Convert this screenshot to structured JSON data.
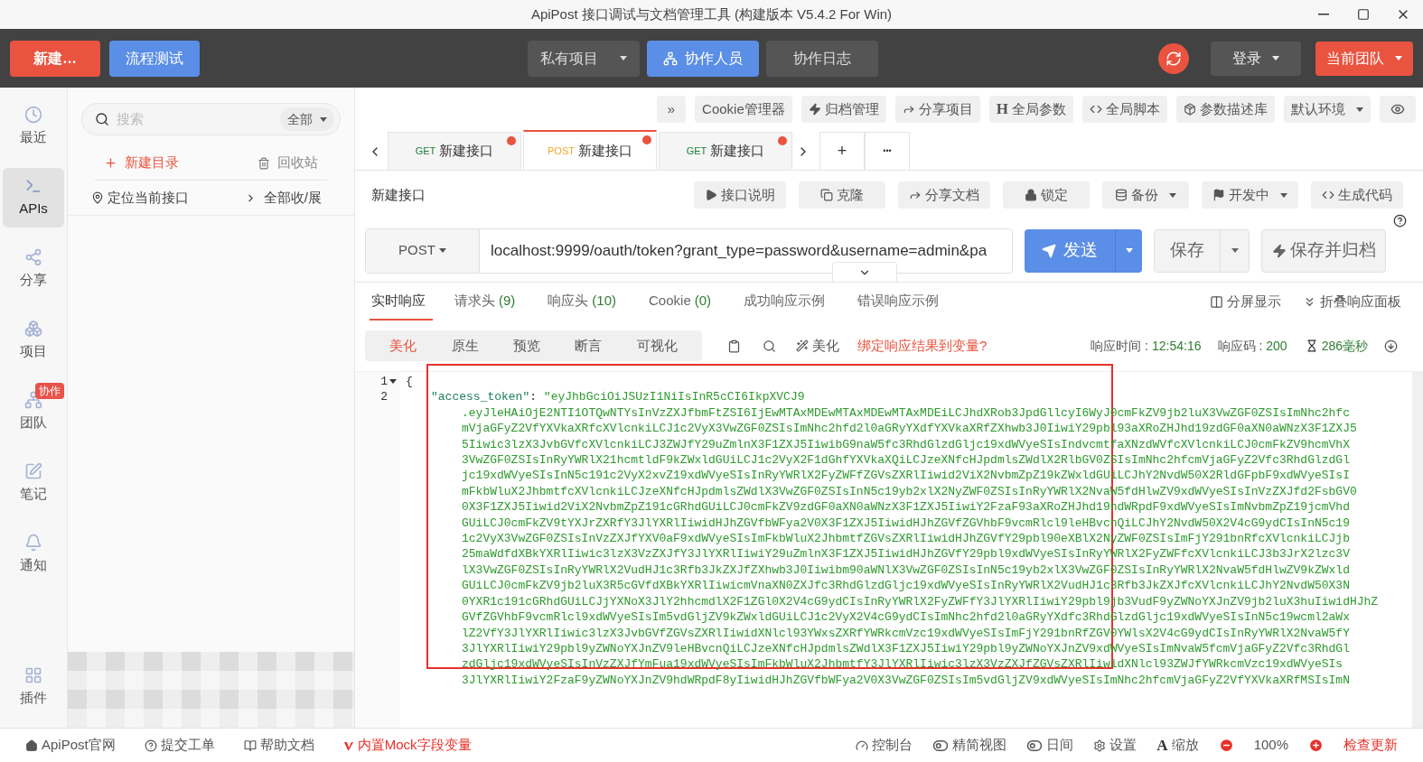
{
  "window": {
    "title": "ApiPost 接口调试与文档管理工具 (构建版本 V5.4.2 For Win)"
  },
  "top_bar": {
    "new_button": "新建…",
    "flow_button": "流程测试",
    "tabs": [
      {
        "label": "私有项目",
        "kind": "dropdown",
        "selected": false
      },
      {
        "label": "协作人员",
        "kind": "team",
        "selected": true
      },
      {
        "label": "协作日志",
        "kind": "plain",
        "selected": false
      }
    ],
    "login": "登录",
    "team": "当前团队"
  },
  "rail": {
    "items": [
      {
        "label": "最近",
        "kind": "clock",
        "selected": false
      },
      {
        "label": "APIs",
        "kind": "terminal",
        "selected": true
      },
      {
        "label": "分享",
        "kind": "share",
        "selected": false
      },
      {
        "label": "项目",
        "kind": "boxes",
        "selected": false
      },
      {
        "label": "团队",
        "kind": "team",
        "selected": false,
        "badge": "协作"
      },
      {
        "label": "笔记",
        "kind": "note",
        "selected": false
      },
      {
        "label": "通知",
        "kind": "bell",
        "selected": false
      }
    ],
    "bottom": {
      "label": "插件",
      "kind": "grid",
      "selected": false
    }
  },
  "sidebar": {
    "search": {
      "placeholder": "搜索",
      "filter": "全部"
    },
    "new_folder": "新建目录",
    "trash": "回收站",
    "locate": "定位当前接口",
    "toggle_all": "全部收/展"
  },
  "toolbar": [
    {
      "kind": "more",
      "label": "»"
    },
    {
      "kind": "plain",
      "label": "Cookie管理器"
    },
    {
      "kind": "bolt",
      "label": "归档管理"
    },
    {
      "kind": "share",
      "label": "分享项目"
    },
    {
      "kind": "glyph",
      "glyph": "H",
      "label": "全局参数"
    },
    {
      "kind": "code",
      "label": "全局脚本"
    },
    {
      "kind": "box",
      "label": "参数描述库"
    },
    {
      "kind": "dropdown",
      "label": "默认环境"
    },
    {
      "kind": "eye"
    }
  ],
  "tabs": [
    {
      "method": "GET",
      "label": "新建接口",
      "unsaved": true,
      "selected": false
    },
    {
      "method": "POST",
      "label": "新建接口",
      "unsaved": true,
      "selected": true
    },
    {
      "method": "GET",
      "label": "新建接口",
      "unsaved": true,
      "selected": false
    }
  ],
  "tab_controls": {
    "add": "+",
    "more": "•••"
  },
  "request": {
    "name": "新建接口",
    "actions": [
      {
        "kind": "play",
        "label": "接口说明"
      },
      {
        "kind": "copy",
        "label": "克隆"
      },
      {
        "kind": "share",
        "label": "分享文档"
      },
      {
        "kind": "lock",
        "label": "锁定"
      },
      {
        "kind": "database",
        "label": "备份",
        "dropdown": true
      },
      {
        "kind": "flag",
        "label": "开发中",
        "dropdown": true
      },
      {
        "kind": "code",
        "label": "生成代码"
      }
    ],
    "method": "POST",
    "url": "localhost:9999/oauth/token?grant_type=password&username=admin&pa",
    "send": "发送",
    "save": "保存",
    "save_archive": "保存并归档"
  },
  "response_tabs": [
    {
      "label": "实时响应",
      "selected": true
    },
    {
      "label": "请求头",
      "count": "(9)",
      "selected": false
    },
    {
      "label": "响应头",
      "count": "(10)",
      "selected": false
    },
    {
      "label": "Cookie",
      "count": "(0)",
      "selected": false
    },
    {
      "label": "成功响应示例",
      "selected": false
    },
    {
      "label": "错误响应示例",
      "selected": false
    }
  ],
  "response_actions": {
    "split": "分屏显示",
    "collapse": "折叠响应面板"
  },
  "view_modes": [
    {
      "label": "美化",
      "selected": true
    },
    {
      "label": "原生",
      "selected": false
    },
    {
      "label": "预览",
      "selected": false
    },
    {
      "label": "断言",
      "selected": false
    },
    {
      "label": "可视化",
      "selected": false
    }
  ],
  "beautify": "美化",
  "bind_link": "绑定响应结果到变量?",
  "meta": {
    "time_label": "响应时间 :",
    "time": "12:54:16",
    "code_label": "响应码 :",
    "code": "200",
    "duration": "286毫秒"
  },
  "code": {
    "line_numbers": [
      "1",
      "2"
    ],
    "open_brace": "{",
    "key": "\"access_token\"",
    "colon": ":",
    "first": "\"eyJhbGciOiJSUzI1NiIsInR5cCI6IkpXVCJ9",
    "lines": [
      ".eyJleHAiOjE2NTI1OTQwNTYsInVzZXJfbmFtZSI6IjEwMTAxMDEwMTAxMDEwMTAxMDEiLCJhdXRob3JpdGllcyI6WyJ0cmFkZV9jb2luX3VwZGF0ZSIsImNhc2hfc",
      "mVjaGFyZ2VfYXVkaXRfcXVlcnkiLCJ1c2VyX3VwZGF0ZSIsImNhc2hfd2l0aGRyYXdfYXVkaXRfZXhwb3J0IiwiY29pbl93aXRoZHJhd19zdGF0aXN0aWNzX3F1ZXJ5",
      "5Iiwic3lzX3JvbGVfcXVlcnkiLCJ3ZWJfY29uZmlnX3F1ZXJ5IiwibG9naW5fc3RhdGlzdGljc19xdWVyeSIsIndvcmtfaXNzdWVfcXVlcnkiLCJ0cmFkZV9hcmVhX",
      "3VwZGF0ZSIsInRyYWRlX21hcmtldF9kZWxldGUiLCJ1c2VyX2F1dGhfYXVkaXQiLCJzeXNfcHJpdmlsZWdlX2RlbGV0ZSIsImNhc2hfcmVjaGFyZ2Vfc3RhdGlzdGl",
      "jc19xdWVyeSIsInN5c191c2VyX2xvZ19xdWVyeSIsInRyYWRlX2FyZWFfZGVsZXRlIiwid2ViX2NvbmZpZ19kZWxldGUiLCJhY2NvdW50X2RldGFpbF9xdWVyeSIsI",
      "mFkbWluX2JhbmtfcXVlcnkiLCJzeXNfcHJpdmlsZWdlX3VwZGF0ZSIsInN5c19yb2xlX2NyZWF0ZSIsInRyYWRlX2NvaW5fdHlwZV9xdWVyeSIsInVzZXJfd2FsbGV0",
      "0X3F1ZXJ5Iiwid2ViX2NvbmZpZ191cGRhdGUiLCJ0cmFkZV9zdGF0aXN0aWNzX3F1ZXJ5IiwiY2FzaF93aXRoZHJhd19hdWRpdF9xdWVyeSIsImNvbmZpZ19jcmVhd",
      "GUiLCJ0cmFkZV9tYXJrZXRfY3JlYXRlIiwidHJhZGVfbWFya2V0X3F1ZXJ5IiwidHJhZGVfZGVhbF9vcmRlcl9leHBvcnQiLCJhY2NvdW50X2V4cG9ydCIsInN5c19",
      "1c2VyX3VwZGF0ZSIsInVzZXJfYXV0aF9xdWVyeSIsImFkbWluX2JhbmtfZGVsZXRlIiwidHJhZGVfY29pbl90eXBlX2NyZWF0ZSIsImFjY291bnRfcXVlcnkiLCJjb",
      "25maWdfdXBkYXRlIiwic3lzX3VzZXJfY3JlYXRlIiwiY29uZmlnX3F1ZXJ5IiwidHJhZGVfY29pbl9xdWVyeSIsInRyYWRlX2FyZWFfcXVlcnkiLCJ3b3JrX2lzc3V",
      "lX3VwZGF0ZSIsInRyYWRlX2VudHJ1c3Rfb3JkZXJfZXhwb3J0Iiwibm90aWNlX3VwZGF0ZSIsInN5c19yb2xlX3VwZGF0ZSIsInRyYWRlX2NvaW5fdHlwZV9kZWxld",
      "GUiLCJ0cmFkZV9jb2luX3R5cGVfdXBkYXRlIiwicmVnaXN0ZXJfc3RhdGlzdGljc19xdWVyeSIsInRyYWRlX2VudHJ1c3Rfb3JkZXJfcXVlcnkiLCJhY2NvdW50X3N",
      "0YXR1c191cGRhdGUiLCJjYXNoX3JlY2hhcmdlX2F1ZGl0X2V4cG9ydCIsInRyYWRlX2FyZWFfY3JlYXRlIiwiY29pbl9jb3VudF9yZWNoYXJnZV9jb2luX3huIiwidHJhZ",
      "GVfZGVhbF9vcmRlcl9xdWVyeSIsIm5vdGljZV9kZWxldGUiLCJ1c2VyX2V4cG9ydCIsImNhc2hfd2l0aGRyYXdfc3RhdGlzdGljc19xdWVyeSIsInN5c19wcml2aWx",
      "lZ2VfY3JlYXRlIiwic3lzX3JvbGVfZGVsZXRlIiwidXNlcl93YWxsZXRfYWRkcmVzc19xdWVyeSIsImFjY291bnRfZGV0YWlsX2V4cG9ydCIsInRyYWRlX2NvaW5fY",
      "3JlYXRlIiwiY29pbl9yZWNoYXJnZV9leHBvcnQiLCJzeXNfcHJpdmlsZWdlX3F1ZXJ5IiwiY29pbl9yZWNoYXJnZV9xdWVyeSIsImNvaW5fcmVjaGFyZ2Vfc3RhdGl",
      "zdGljc19xdWVyeSIsInVzZXJfYmFua19xdWVyeSIsImFkbWluX2JhbmtfY3JlYXRlIiwic3lzX3VzZXJfZGVsZXRlIiwidXNlcl93ZWJfYWRkcmVzc19xdWVyeSIs",
      "3JlYXRlIiwiY2FzaF9yZWNoYXJnZV9hdWRpdF8yIiwidHJhZGVfbWFya2V0X3VwZGF0ZSIsIm5vdGljZV9xdWVyeSIsImNhc2hfcmVjaGFyZ2VfYXVkaXRfMSIsImN"
    ]
  },
  "status_bar": {
    "left": [
      {
        "kind": "home",
        "label": "ApiPost官网"
      },
      {
        "kind": "help",
        "label": "提交工单"
      },
      {
        "kind": "book",
        "label": "帮助文档"
      },
      {
        "kind": "mock",
        "label": "内置Mock字段变量"
      }
    ],
    "right": [
      {
        "kind": "console",
        "label": "控制台"
      },
      {
        "kind": "toggle",
        "label": "精简视图"
      },
      {
        "kind": "toggle",
        "label": "日间"
      },
      {
        "kind": "gear",
        "label": "设置"
      },
      {
        "kind": "zoom",
        "glyph": "A",
        "label": "缩放"
      }
    ],
    "zoom_value": "100%",
    "update": "检查更新"
  }
}
